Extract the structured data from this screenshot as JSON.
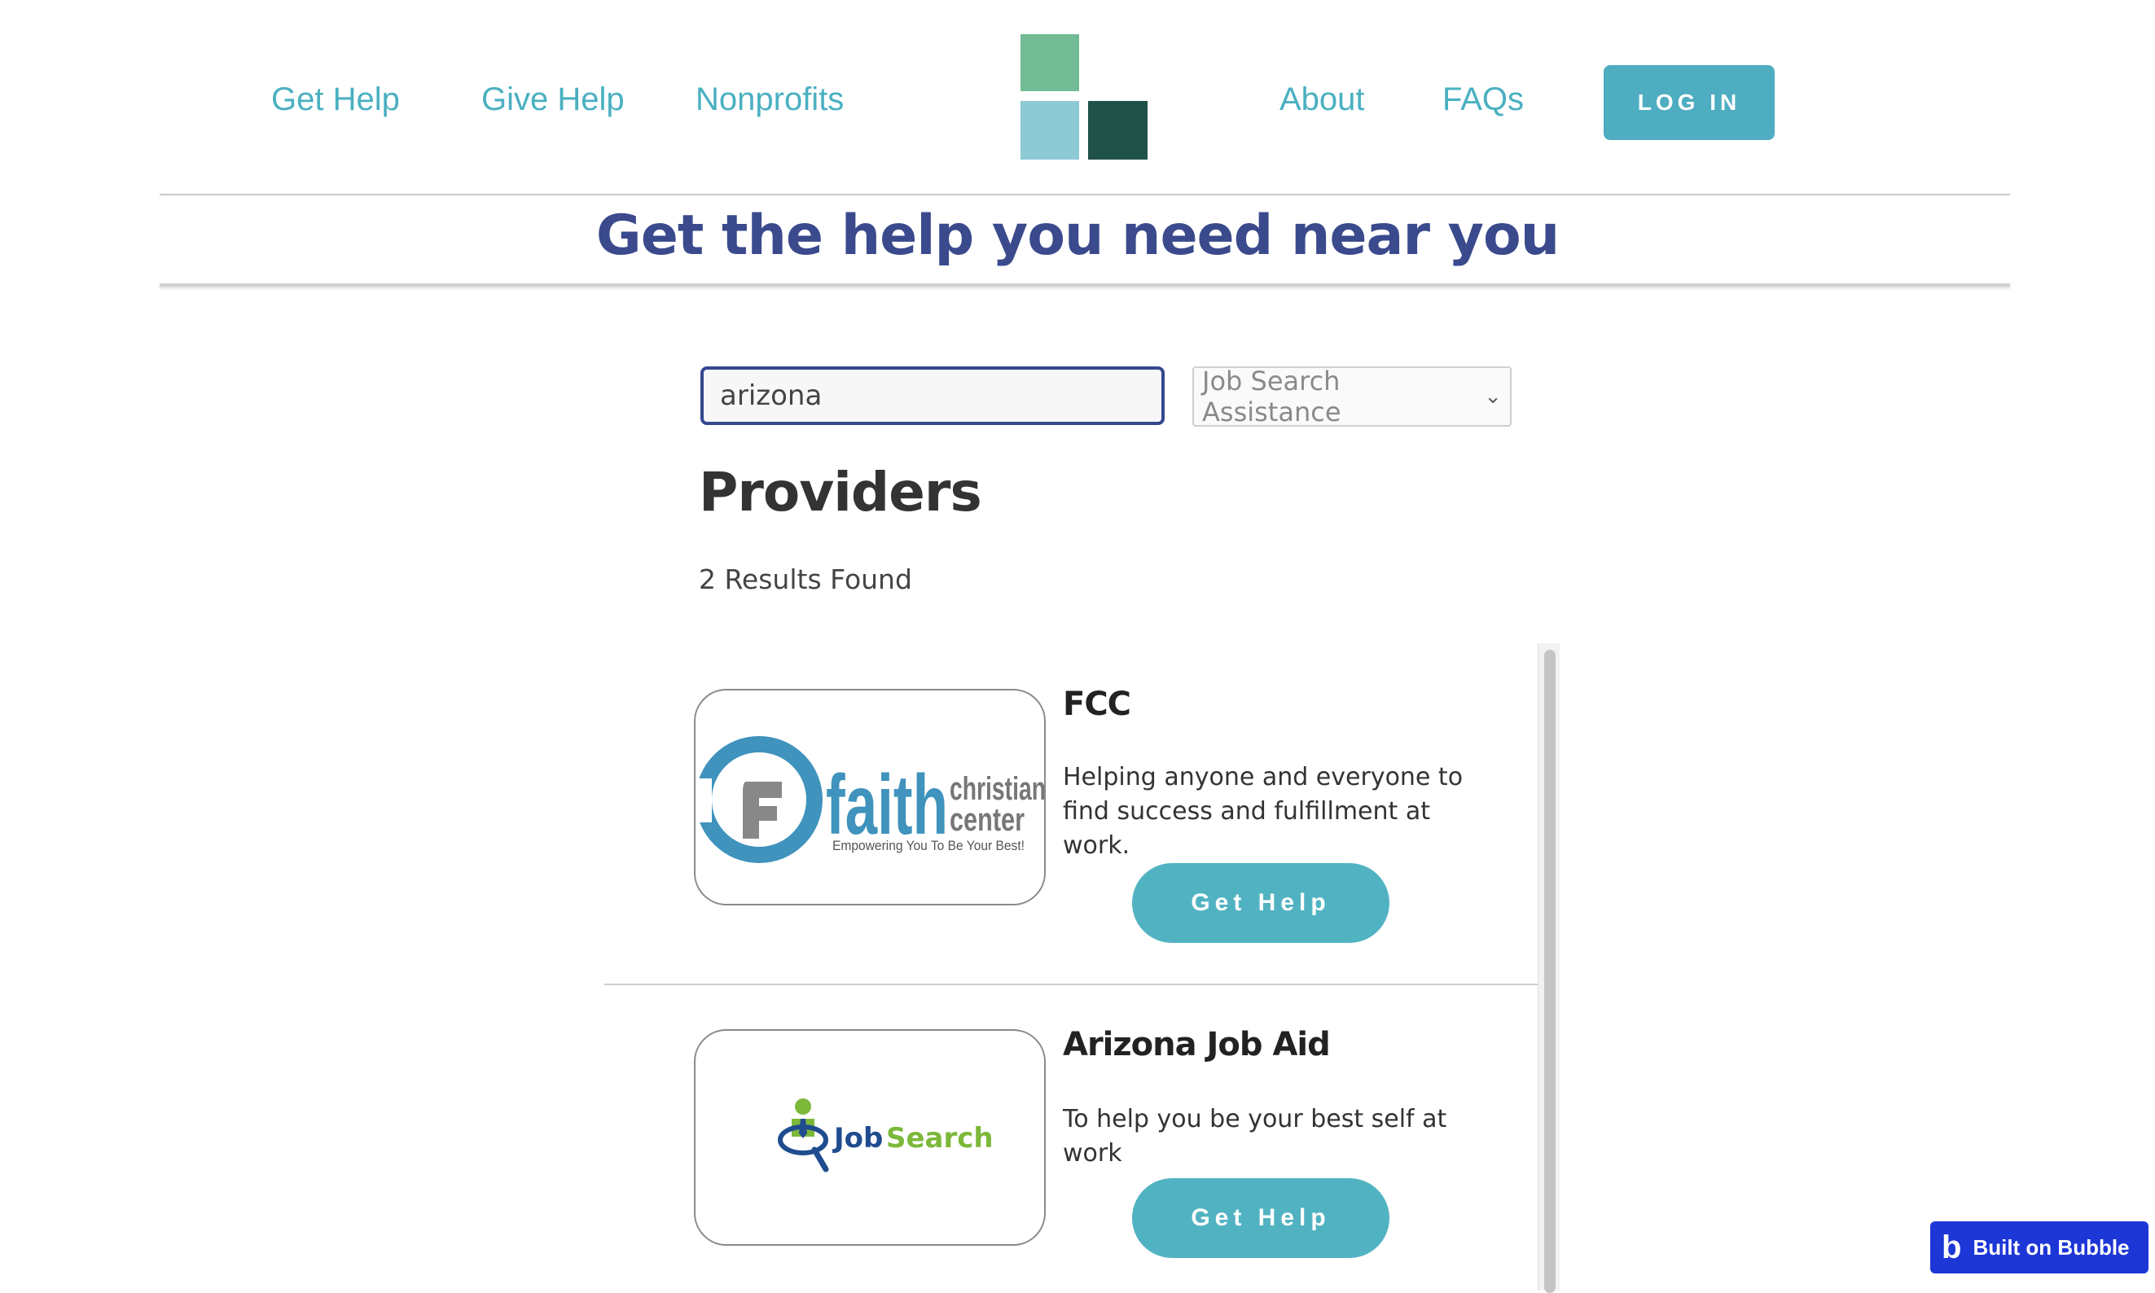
{
  "nav": {
    "left_links": [
      "Get Help",
      "Give Help",
      "Nonprofits"
    ],
    "right_links": [
      "About",
      "FAQs"
    ],
    "login_label": "LOG IN"
  },
  "logo": {
    "colors": {
      "top": "#72bb95",
      "bottom_left": "#8ecad5",
      "bottom_right": "#21524a"
    }
  },
  "hero": {
    "title": "Get the help you need near you"
  },
  "search": {
    "value": "arizona",
    "category_selected": "Job Search Assistance"
  },
  "providers": {
    "heading": "Providers",
    "results_text": "2 Results Found",
    "items": [
      {
        "name": "FCC",
        "description": "Helping anyone and everyone to find success and fulfillment at work.",
        "button_label": "Get Help",
        "logo": {
          "word_big": "faith",
          "word_top": "christian",
          "word_bottom": "center",
          "tagline": "Empowering You To Be Your Best!"
        }
      },
      {
        "name": "Arizona Job Aid",
        "description": "To help you be your best self at work",
        "button_label": "Get Help",
        "logo": {
          "word1": "Job",
          "word2": "Search"
        }
      }
    ]
  },
  "badge": {
    "label": "Built on Bubble",
    "mark": "b"
  },
  "colors": {
    "accent": "#4eadc0",
    "title_blue": "#3a4a8c",
    "badge_blue": "#1d36d6"
  }
}
